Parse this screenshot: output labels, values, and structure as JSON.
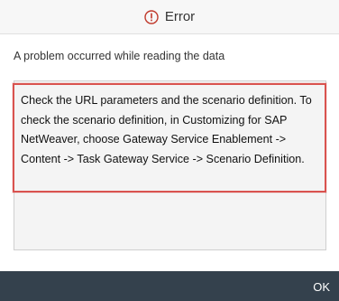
{
  "dialog": {
    "title": "Error",
    "message": "A problem occurred while reading the data",
    "details": "Check the URL parameters and the scenario definition. To check the scenario definition, in Customizing for SAP NetWeaver, choose Gateway Service Enablement -> Content -> Task Gateway Service -> Scenario Definition.",
    "ok_label": "OK"
  },
  "colors": {
    "error_red": "#c0392b",
    "highlight_border": "#d9534f",
    "footer_bg": "#34414d"
  },
  "icons": {
    "title_icon": "error-circle-icon"
  }
}
